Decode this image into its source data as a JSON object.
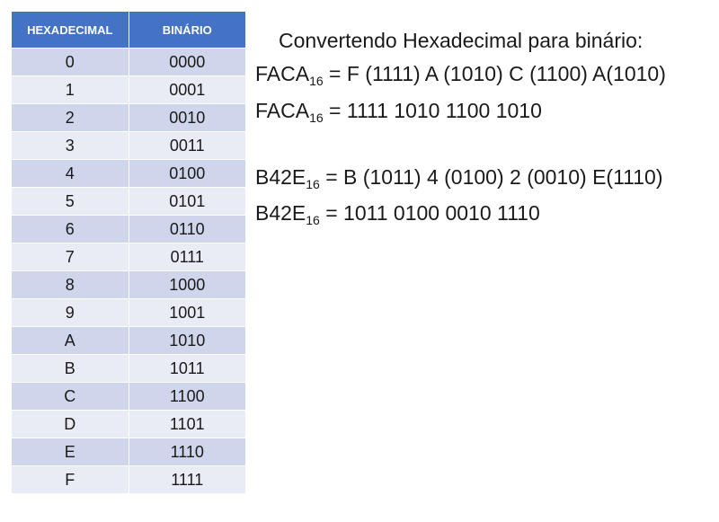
{
  "table": {
    "headers": [
      "HEXADECIMAL",
      "BINÁRIO"
    ],
    "rows": [
      [
        "0",
        "0000"
      ],
      [
        "1",
        "0001"
      ],
      [
        "2",
        "0010"
      ],
      [
        "3",
        "0011"
      ],
      [
        "4",
        "0100"
      ],
      [
        "5",
        "0101"
      ],
      [
        "6",
        "0110"
      ],
      [
        "7",
        "0111"
      ],
      [
        "8",
        "1000"
      ],
      [
        "9",
        "1001"
      ],
      [
        "A",
        "1010"
      ],
      [
        "B",
        "1011"
      ],
      [
        "C",
        "1100"
      ],
      [
        "D",
        "1101"
      ],
      [
        "E",
        "1110"
      ],
      [
        "F",
        "1111"
      ]
    ]
  },
  "content": {
    "title": "Convertendo Hexadecimal para binário:",
    "lines": [
      {
        "base": "FACA",
        "sub": "16",
        "rest": " = F (1111) A (1010) C (1100) A(1010)"
      },
      {
        "base": "FACA",
        "sub": "16",
        "rest": " = 1111 1010 1100 1010"
      },
      {
        "base": "B42E",
        "sub": "16",
        "rest": " = B (1011) 4 (0100) 2 (0010) E(1110)"
      },
      {
        "base": "B42E",
        "sub": "16",
        "rest": " = 1011 0100 0010 1110"
      }
    ]
  },
  "colors": {
    "header_bg": "#4472c4",
    "row_odd": "#cfd5ea",
    "row_even": "#e9ebf5"
  }
}
